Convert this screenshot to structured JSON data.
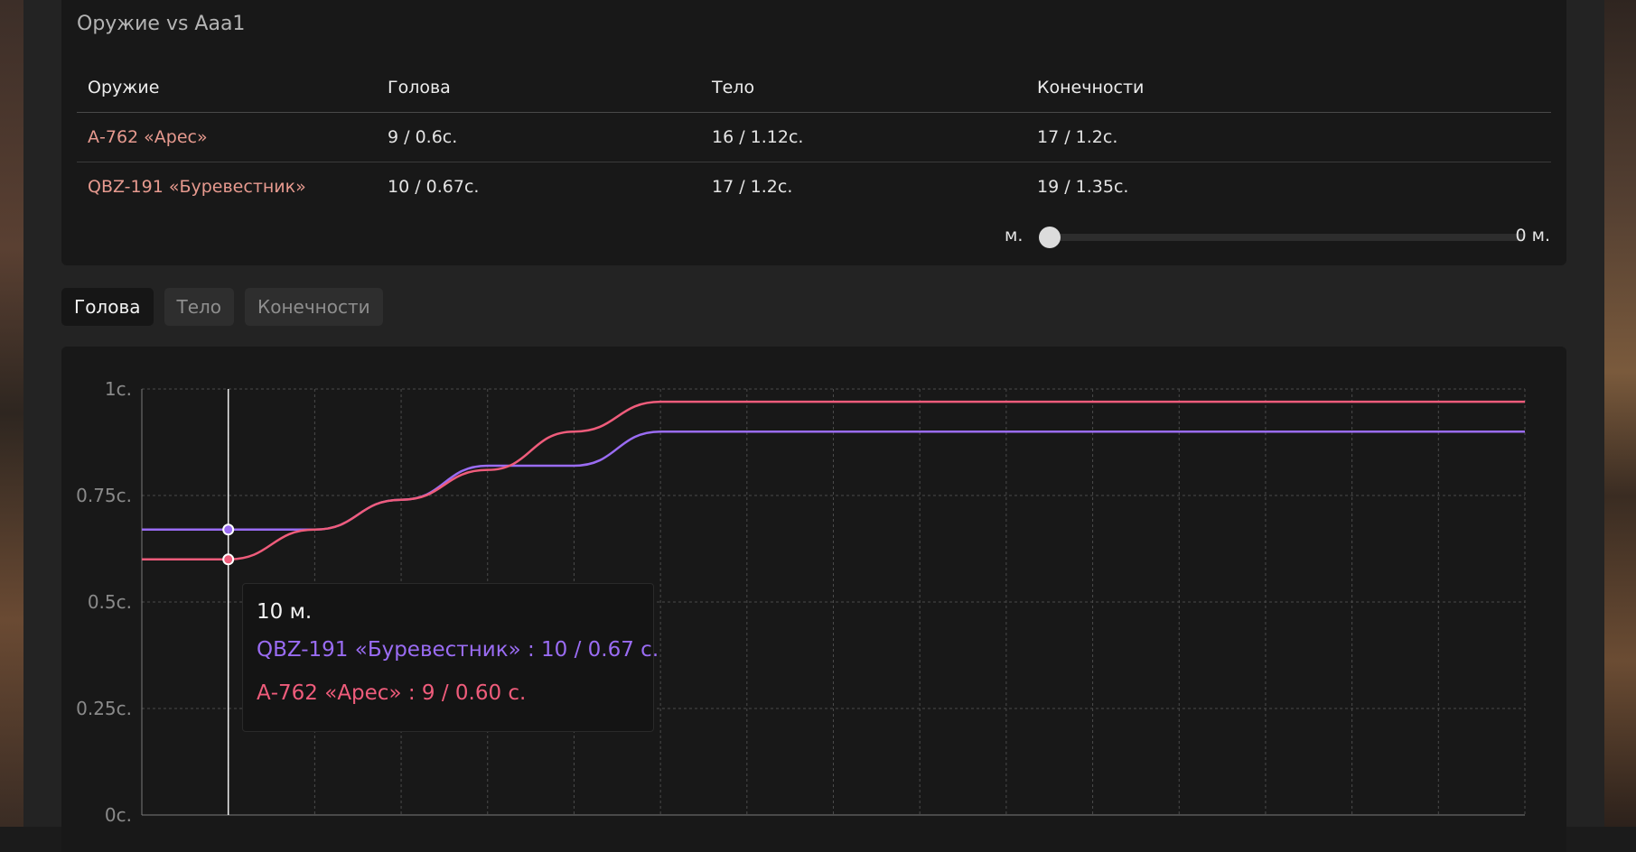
{
  "card_title": "Оружие vs Aaa1",
  "table": {
    "headers": [
      "Оружие",
      "Голова",
      "Тело",
      "Конечности"
    ],
    "rows": [
      {
        "weapon": "А-762 «Арес»",
        "head": "9 / 0.6с.",
        "body": "16 / 1.12с.",
        "limbs": "17 / 1.2с."
      },
      {
        "weapon": "QBZ-191 «Буревестник»",
        "head": "10 / 0.67с.",
        "body": "17 / 1.2с.",
        "limbs": "19 / 1.35с."
      }
    ]
  },
  "range": {
    "left_label": "м.",
    "right_label": "0 м.",
    "value": 0
  },
  "tabs": [
    {
      "label": "Голова",
      "active": true
    },
    {
      "label": "Тело",
      "active": false
    },
    {
      "label": "Конечности",
      "active": false
    }
  ],
  "colors": {
    "series_purple": "#9a6cf3",
    "series_red": "#ef5c7b",
    "weapon_link": "#e79a8f"
  },
  "tooltip": {
    "title": "10 м.",
    "lines": [
      "QBZ-191 «Буревестник» : 10 / 0.67 с.",
      "А-762 «Арес» : 9 / 0.60 с."
    ]
  },
  "chart_data": {
    "type": "line",
    "ylim": [
      0,
      1
    ],
    "xlim": [
      0,
      160
    ],
    "y_ticks": [
      {
        "value": 1,
        "label": "1с."
      },
      {
        "value": 0.75,
        "label": "0.75с."
      },
      {
        "value": 0.5,
        "label": "0.5с."
      },
      {
        "value": 0.25,
        "label": "0.25с."
      },
      {
        "value": 0,
        "label": "0с."
      }
    ],
    "grid": true,
    "x_grid_step": 10,
    "cursor_x": 10,
    "series": [
      {
        "name": "QBZ-191 «Буревестник»",
        "color": "#9a6cf3",
        "x": [
          0,
          10,
          20,
          30,
          40,
          50,
          60,
          70,
          160
        ],
        "y": [
          0.67,
          0.67,
          0.67,
          0.74,
          0.82,
          0.82,
          0.9,
          0.9,
          0.9
        ]
      },
      {
        "name": "А-762 «Арес»",
        "color": "#ef5c7b",
        "x": [
          0,
          10,
          20,
          30,
          40,
          50,
          60,
          70,
          160
        ],
        "y": [
          0.6,
          0.6,
          0.67,
          0.74,
          0.81,
          0.9,
          0.97,
          0.97,
          0.97
        ]
      }
    ]
  }
}
